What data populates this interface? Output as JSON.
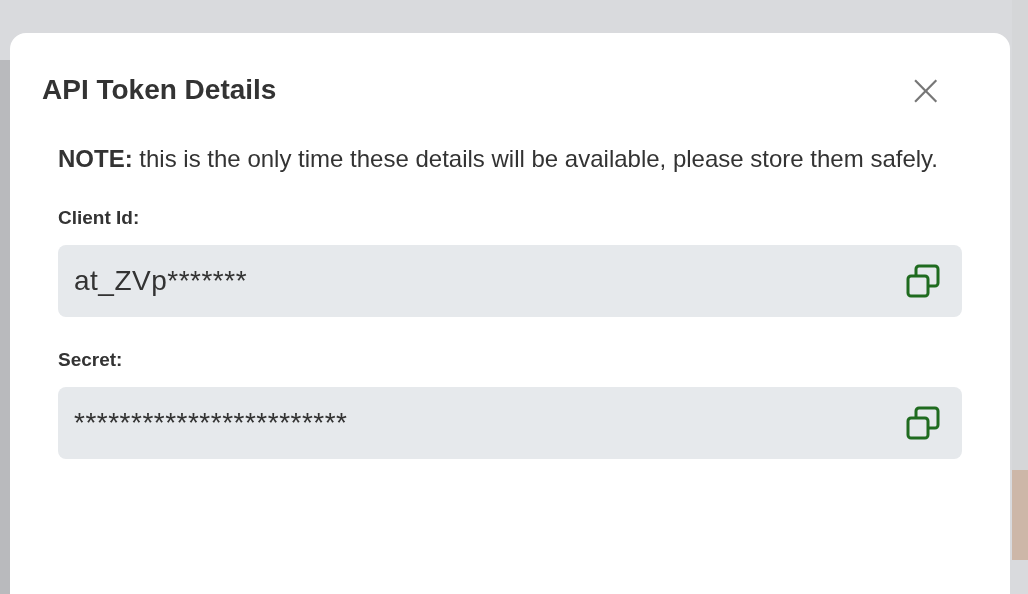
{
  "dialog": {
    "title": "API Token Details",
    "close": "×",
    "note": "**NOTE:** this is the only time these details will be available, please store them safely.",
    "fields": [
      {
        "label": "Client Id:",
        "value": "at_ZVp*******"
      },
      {
        "label": "Secret:",
        "value": "************************"
      }
    ]
  }
}
